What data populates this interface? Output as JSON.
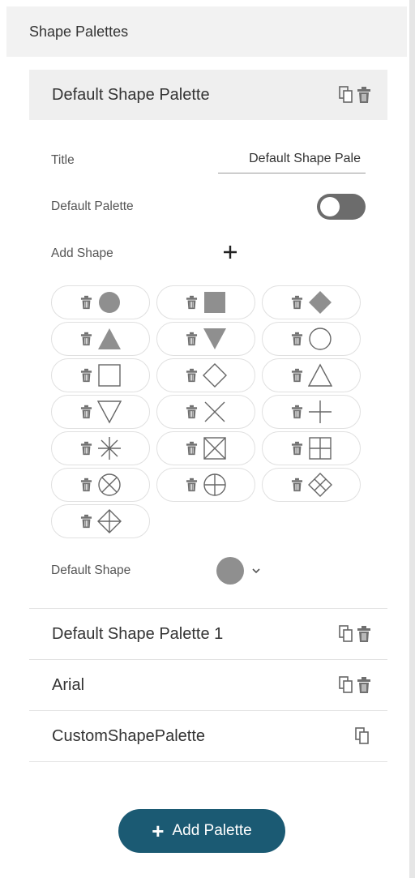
{
  "header": {
    "title": "Shape Palettes"
  },
  "selected_palette": {
    "name": "Default Shape Palette",
    "icons": [
      "copy-icon",
      "trash-icon"
    ]
  },
  "editor": {
    "title_label": "Title",
    "title_value": "Default Shape Pale",
    "default_palette_label": "Default Palette",
    "default_palette_on": false,
    "add_shape_label": "Add Shape",
    "add_shape_icon": "plus-icon",
    "shapes": [
      "filled-circle",
      "filled-square",
      "filled-diamond",
      "filled-triangle-up",
      "filled-triangle-down",
      "circle",
      "square",
      "diamond",
      "triangle-up",
      "triangle-down",
      "x-cross",
      "plus",
      "asterisk",
      "square-x",
      "square-plus",
      "circle-x",
      "circle-plus",
      "diamond-x",
      "diamond-plus"
    ],
    "default_shape_label": "Default Shape",
    "default_shape": "filled-circle"
  },
  "palettes": [
    {
      "name": "Default Shape Palette 1",
      "icons": [
        "copy-icon",
        "trash-icon"
      ]
    },
    {
      "name": "Arial",
      "icons": [
        "copy-icon",
        "trash-icon"
      ]
    },
    {
      "name": "CustomShapePalette",
      "icons": [
        "copy-icon"
      ]
    }
  ],
  "add_palette": {
    "label": "Add Palette",
    "icon": "plus-icon"
  },
  "colors": {
    "header_bg": "#f2f2f2",
    "selected_bg": "#efefef",
    "shape_fill": "#8f8f8f",
    "toggle_off": "#6c6c6c",
    "button_bg": "#1b5a73"
  }
}
